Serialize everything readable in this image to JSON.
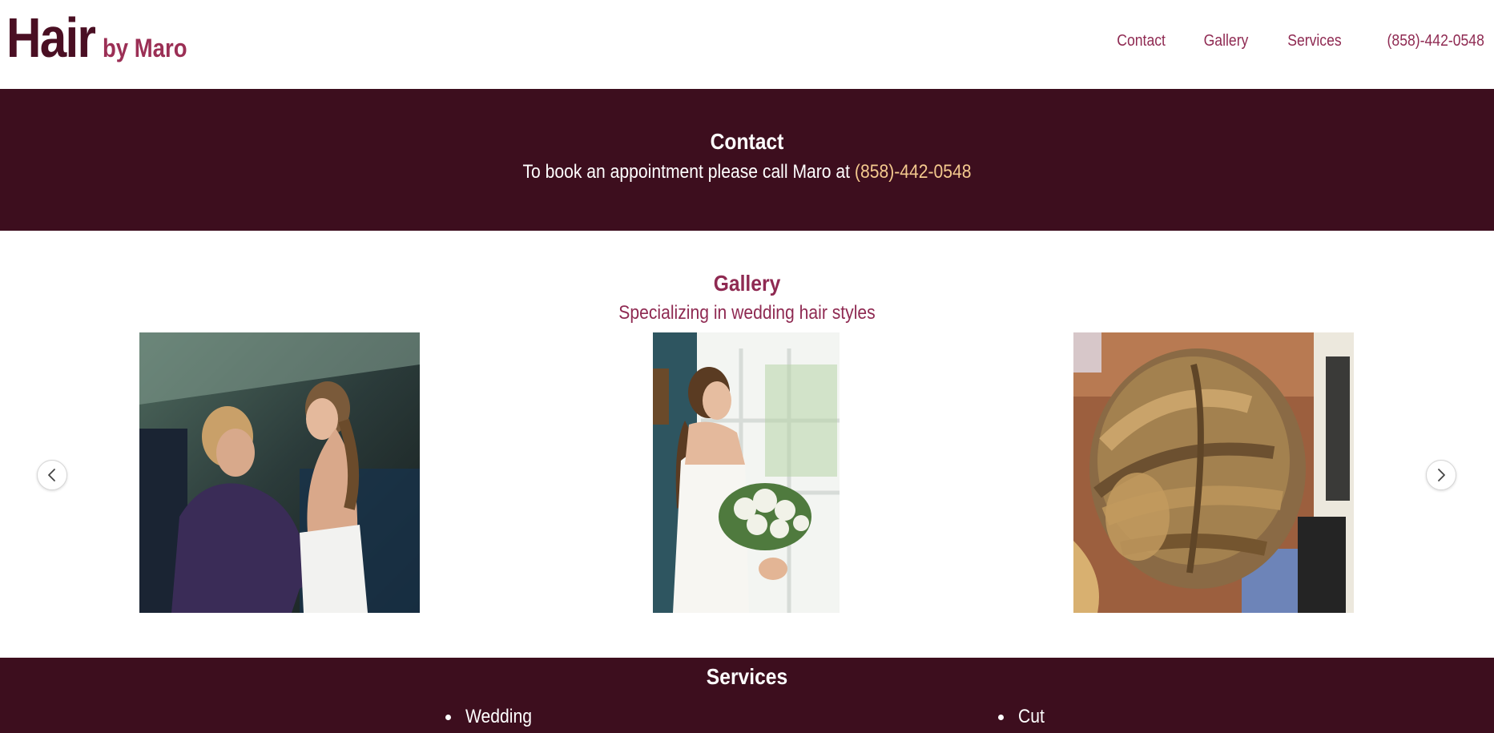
{
  "header": {
    "brand_main": "Hair",
    "brand_sub": "by Maro",
    "nav": [
      {
        "label": "Contact"
      },
      {
        "label": "Gallery"
      },
      {
        "label": "Services"
      },
      {
        "label": "(858)-442-0548"
      }
    ]
  },
  "contact": {
    "title": "Contact",
    "text": "To book an appointment please call Maro at",
    "phone": "(858)-442-0548"
  },
  "gallery": {
    "title": "Gallery",
    "subtitle": "Specializing in wedding hair styles",
    "photos": [
      {
        "alt": "bride with mother"
      },
      {
        "alt": "bride holding bouquet by window"
      },
      {
        "alt": "braided updo hairstyle"
      }
    ],
    "prev_icon": "chevron-left-icon",
    "next_icon": "chevron-right-icon"
  },
  "services": {
    "title": "Services",
    "items": [
      {
        "label": "Wedding"
      },
      {
        "label": "Cut"
      }
    ]
  },
  "colors": {
    "brand_dark": "#4a0f23",
    "brand_accent": "#8f2a52",
    "band_bg": "#3d0e1e",
    "phone_highlight": "#f4c98e"
  }
}
